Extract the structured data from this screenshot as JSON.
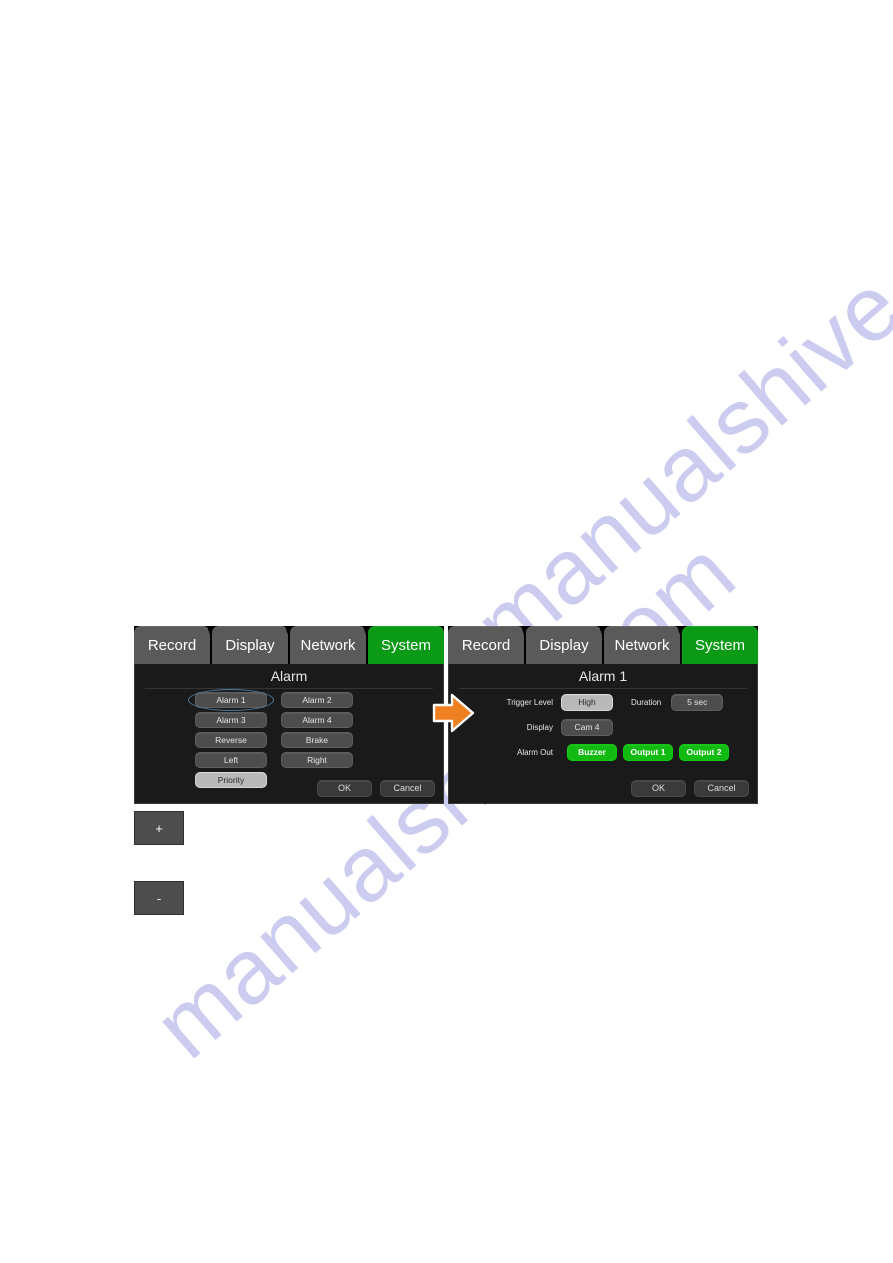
{
  "watermark": {
    "line1": "manualshive.com",
    "line2": "manualshive.com",
    "color": "#ccccf0"
  },
  "colors": {
    "active_tab": "#0a9a16",
    "inactive_tab": "#5a5a5a",
    "panel_bg": "#1a1a1a",
    "button": "#4d4d4d",
    "button_selected": "#b9b9b9",
    "alarm_out_green": "#11bb11",
    "arrow": "#ef8022",
    "ellipse_highlight": "#4e7ca0"
  },
  "screens": [
    {
      "name": "alarm-list-screen",
      "tabs": [
        {
          "label": "Record",
          "active": false
        },
        {
          "label": "Display",
          "active": false
        },
        {
          "label": "Network",
          "active": false
        },
        {
          "label": "System",
          "active": true
        }
      ],
      "title": "Alarm",
      "buttons": [
        {
          "label": "Alarm 1",
          "state": "normal",
          "annotated": true
        },
        {
          "label": "Alarm 2",
          "state": "normal",
          "annotated": false
        },
        {
          "label": "Alarm 3",
          "state": "normal",
          "annotated": false
        },
        {
          "label": "Alarm 4",
          "state": "normal",
          "annotated": false
        },
        {
          "label": "Reverse",
          "state": "normal",
          "annotated": false
        },
        {
          "label": "Brake",
          "state": "normal",
          "annotated": false
        },
        {
          "label": "Left",
          "state": "normal",
          "annotated": false
        },
        {
          "label": "Right",
          "state": "normal",
          "annotated": false
        },
        {
          "label": "Priority",
          "state": "selected",
          "annotated": false
        }
      ],
      "ok_label": "OK",
      "cancel_label": "Cancel"
    },
    {
      "name": "alarm-detail-screen",
      "tabs": [
        {
          "label": "Record",
          "active": false
        },
        {
          "label": "Display",
          "active": false
        },
        {
          "label": "Network",
          "active": false
        },
        {
          "label": "System",
          "active": true
        }
      ],
      "title": "Alarm 1",
      "fields": {
        "trigger_level_label": "Trigger Level",
        "trigger_level_value": "High",
        "duration_label": "Duration",
        "duration_value": "5 sec",
        "display_label": "Display",
        "display_value": "Cam 4",
        "alarm_out_label": "Alarm Out",
        "alarm_out_values": [
          "Buzzer",
          "Output 1",
          "Output 2"
        ]
      },
      "ok_label": "OK",
      "cancel_label": "Cancel"
    }
  ],
  "arrow": {
    "icon": "right-arrow-icon"
  },
  "stepper": {
    "plus_label": "+",
    "minus_label": "-"
  }
}
